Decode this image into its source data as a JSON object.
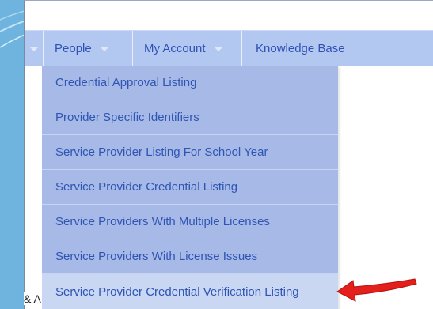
{
  "nav": {
    "people_label": "People",
    "account_label": "My Account",
    "kb_label": "Knowledge Base"
  },
  "dropdown": {
    "items": [
      "Credential Approval Listing",
      "Provider Specific Identifiers",
      "Service Provider Listing For School Year",
      "Service Provider Credential Listing",
      "Service Providers With Multiple Licenses",
      "Service Providers With License Issues",
      "Service Provider Credential Verification Listing"
    ],
    "highlighted_index": 6
  },
  "page": {
    "partial_text": "& A"
  },
  "colors": {
    "navbar": "#b3c8f0",
    "link": "#2e51b5",
    "dropdown": "#a7b9e6",
    "highlight": "#c9d7f3",
    "arrow": "#e3201b",
    "background": "#6fb4de"
  },
  "icons": {
    "caret": "chevron-down-icon",
    "pointer": "red-arrow-icon"
  }
}
